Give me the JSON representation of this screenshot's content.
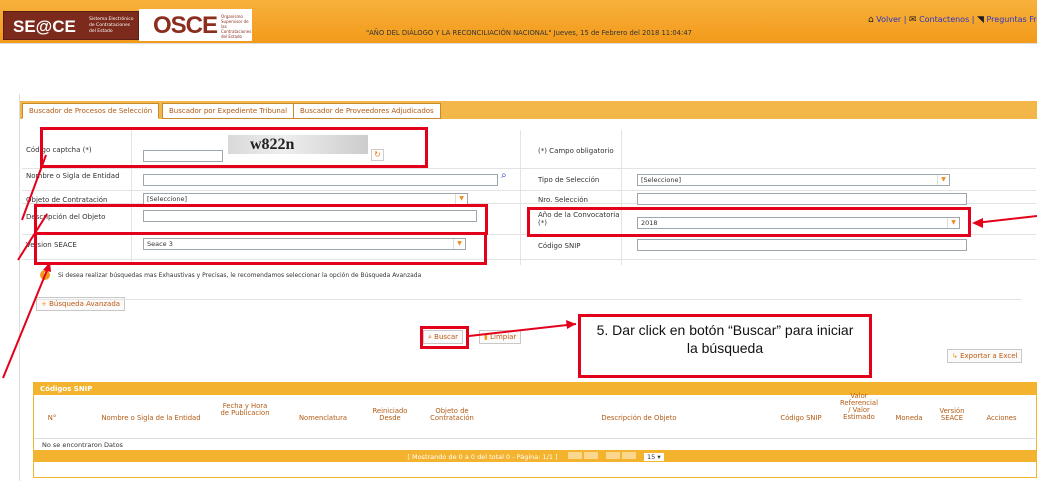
{
  "header": {
    "logo_seace": "SE@CE",
    "logo_seace_sub": "Sistema Electrónico de Contrataciones del Estado",
    "logo_osce": "OSCE",
    "logo_osce_sub": "Organismo Supervisor de las Contrataciones del Estado",
    "motto": "\"AÑO DEL DIÁLOGO Y LA RECONCILIACIÓN NACIONAL\"    Jueves, 15 de Febrero del 2018 11:04:47",
    "links": {
      "volver": "Volver",
      "contactenos": "Contactenos",
      "preguntas": "Preguntas Fre"
    }
  },
  "tabs": [
    "Buscador de Procesos de Selección",
    "Buscador por Expediente Tribunal",
    "Buscador de Proveedores Adjudicados"
  ],
  "form": {
    "captcha_label": "Código captcha (*)",
    "captcha_text": "w822n",
    "mandatory_note": "(*) Campo obligatorio",
    "entidad_label": "Nombre o Sigla de Entidad",
    "tipo_label": "Tipo de Selección",
    "tipo_value": "[Seleccione]",
    "objeto_label": "Objeto de Contratación",
    "objeto_value": "[Seleccione]",
    "nro_label": "Nro. Selección",
    "descripcion_label": "Descripción del Objeto",
    "anio_label": "Año de la Convocatoria (*)",
    "anio_value": "2018",
    "version_label": "Version SEACE",
    "version_value": "Seace 3",
    "snip_label": "Código SNIP"
  },
  "info_text": "Si desea realizar búsquedas mas Exhaustivas y Precisas, le recomendamos seleccionar la opción de Búsqueda Avanzada",
  "buttons": {
    "avanzada": "Búsqueda Avanzada",
    "buscar": "Buscar",
    "limpiar": "Limpiar",
    "exportar": "Exportar a Excel"
  },
  "callout": "5. Dar click en botón “Buscar” para iniciar la búsqueda",
  "table": {
    "title": "Códigos SNIP",
    "headers": [
      "N°",
      "Nombre o Sigla de la Entidad",
      "Fecha y Hora de Publicacion",
      "Nomenclatura",
      "Reiniciado Desde",
      "Objeto de Contratación",
      "Descripción de Objeto",
      "Código SNIP",
      "Valor Referencial / Valor Estimado",
      "Moneda",
      "Versión SEACE",
      "Acciones"
    ],
    "empty": "No se encontraron Datos",
    "pager": "[ Mostrando de 0 a 0 del total 0 - Página: 1/1 ]",
    "page_size": "15"
  },
  "colors": {
    "accent": "#f3b32e",
    "red": "#e3001b",
    "link": "#2a36c8"
  }
}
